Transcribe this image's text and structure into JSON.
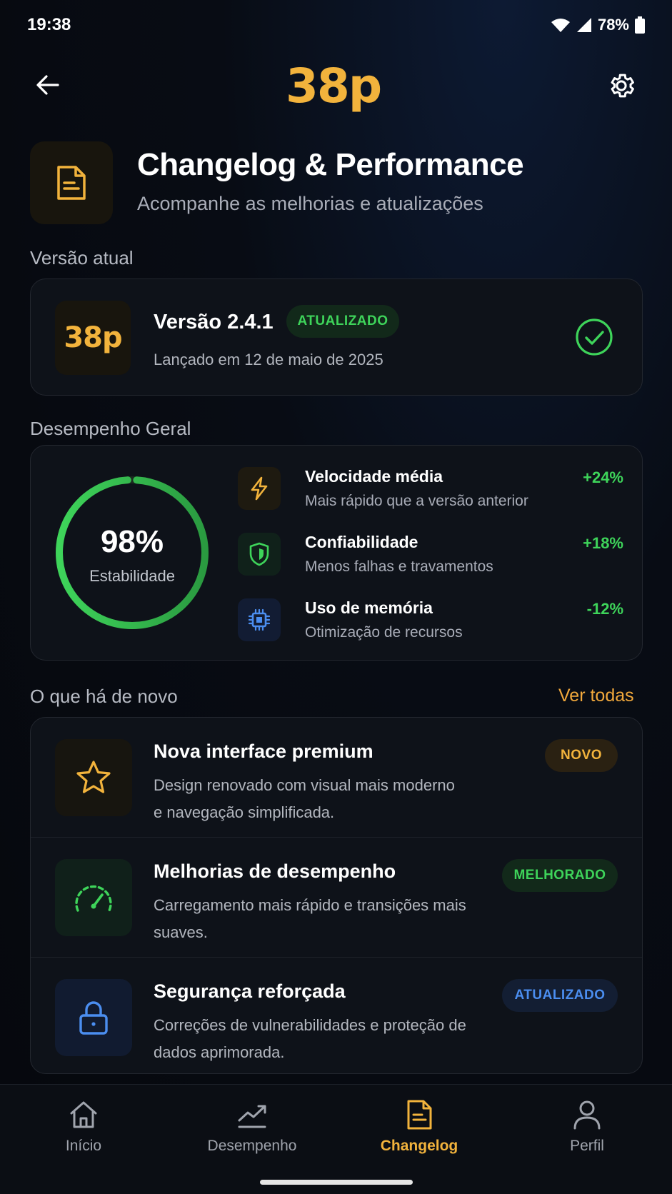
{
  "status_bar": {
    "time": "19:38",
    "battery": "78%"
  },
  "header": {
    "logo": "38p"
  },
  "hero": {
    "title": "Changelog & Performance",
    "subtitle": "Acompanhe as melhorias e atualizações"
  },
  "current_version": {
    "section_label": "Versão atual",
    "logo": "38p",
    "title": "Versão 2.4.1",
    "badge": "ATUALIZADO",
    "release_date": "Lançado em 12 de maio de 2025"
  },
  "performance": {
    "section_label": "Desempenho Geral",
    "stability_value": "98%",
    "stability_fraction": 0.98,
    "stability_label": "Estabilidade",
    "metrics": [
      {
        "name": "Velocidade média",
        "desc": "Mais rápido que a versão anterior",
        "delta": "+24%",
        "icon": "lightning-icon"
      },
      {
        "name": "Confiabilidade",
        "desc": "Menos falhas e travamentos",
        "delta": "+18%",
        "icon": "shield-icon"
      },
      {
        "name": "Uso de memória",
        "desc": "Otimização de recursos",
        "delta": "-12%",
        "icon": "chip-icon"
      }
    ]
  },
  "whats_new": {
    "section_label": "O que há de novo",
    "see_all": "Ver todas",
    "items": [
      {
        "title": "Nova interface premium",
        "desc": "Design renovado com visual mais moderno e navegação simplificada.",
        "badge": "NOVO",
        "icon": "star-icon"
      },
      {
        "title": "Melhorias de desempenho",
        "desc": "Carregamento mais rápido e transições mais suaves.",
        "badge": "MELHORADO",
        "icon": "speedometer-icon"
      },
      {
        "title": "Segurança reforçada",
        "desc": "Correções de vulnerabilidades e proteção de dados aprimorada.",
        "badge": "ATUALIZADO",
        "icon": "lock-icon"
      }
    ]
  },
  "bottom_nav": {
    "items": [
      {
        "label": "Início",
        "icon": "home-icon"
      },
      {
        "label": "Desempenho",
        "icon": "chart-icon"
      },
      {
        "label": "Changelog",
        "icon": "document-icon",
        "active": true
      },
      {
        "label": "Perfil",
        "icon": "user-icon"
      }
    ]
  },
  "colors": {
    "accent_gold": "#f2b33c",
    "success_green": "#3ed45a",
    "info_blue": "#4b8ef0",
    "background": "#080c14"
  }
}
